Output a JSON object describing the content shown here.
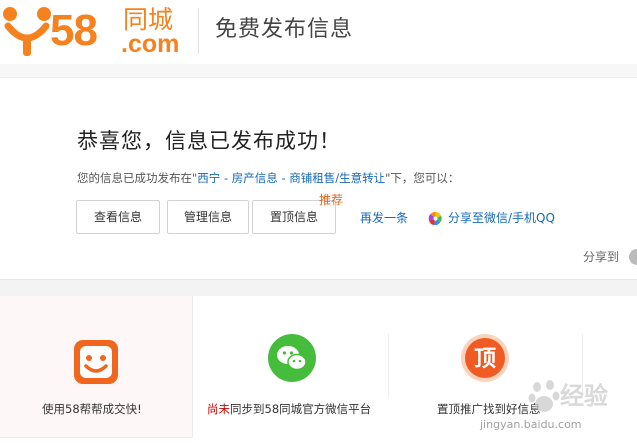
{
  "header": {
    "logo_num": "58",
    "logo_cn": "同城",
    "logo_com": ".com",
    "title": "免费发布信息"
  },
  "success": {
    "title": "恭喜您，信息已发布成功！",
    "desc_prefix": "您的信息已成功发布在\"",
    "desc_path": "西宁 - 房产信息 - 商铺租售/生意转让",
    "desc_suffix": "\"下，您可以："
  },
  "actions": {
    "view_label": "查看信息",
    "manage_label": "管理信息",
    "top_label": "置顶信息",
    "recommend_tag": "推荐",
    "republish_label": "再发一条",
    "share_wechat_label": "分享至微信/手机QQ"
  },
  "share": {
    "label": "分享到"
  },
  "cards": [
    {
      "text": "使用58帮帮成交快!",
      "icon": "bangbang-smile-icon"
    },
    {
      "text_red": "尚未",
      "text": "同步到58同城官方微信平台",
      "icon": "wechat-icon"
    },
    {
      "text": "置顶推广找到好信息",
      "icon": "ding-top-icon"
    }
  ],
  "watermark": {
    "text": "经验",
    "url": "jingyan.baidu.com"
  },
  "colors": {
    "brand": "#f5821f",
    "link": "#1769b5",
    "accent": "#e8641b",
    "wechat_green": "#46bc3c",
    "alert_red": "#c80000"
  }
}
